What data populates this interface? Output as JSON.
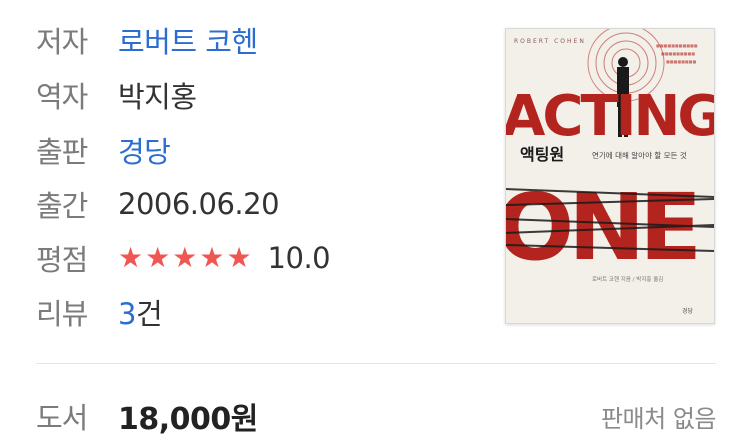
{
  "info": {
    "author": {
      "label": "저자",
      "value": "로버트 코헨"
    },
    "translator": {
      "label": "역자",
      "value": "박지홍"
    },
    "publisher": {
      "label": "출판",
      "value": "경당"
    },
    "date": {
      "label": "출간",
      "value": "2006.06.20"
    },
    "rating": {
      "label": "평점",
      "stars": 5,
      "max": 5,
      "value": "10.0"
    },
    "reviews": {
      "label": "리뷰",
      "count": "3",
      "unit": "건"
    }
  },
  "price": {
    "label": "도서",
    "value": "18,000",
    "unit": "원",
    "seller_status": "판매처 없음"
  },
  "cover": {
    "author_en": "ROBERT COHEN",
    "title_top": "ACTING",
    "title_bottom": "ONE",
    "title_kr": "액팅원",
    "subtitle": "연기에 대해 알아야 할 모든 것",
    "credits": "로버트 코헨 지음 / 박지홍 옮김",
    "publisher_mark": "경당"
  },
  "colors": {
    "link": "#2c6dd2",
    "star": "#ef5753",
    "cover_red": "#b3241e"
  }
}
